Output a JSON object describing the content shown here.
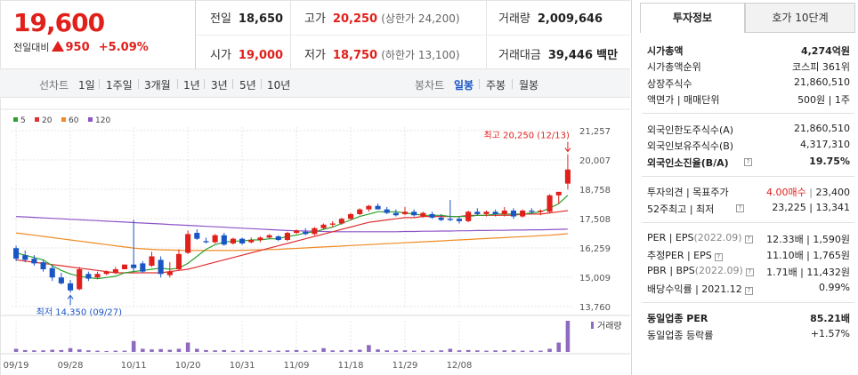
{
  "stock": {
    "price": "19,600",
    "change_label": "전일대비",
    "change_value": "950",
    "change_pct": "+5.09%"
  },
  "quote": {
    "prev_close_label": "전일",
    "prev_close": "18,650",
    "high_label": "고가",
    "high": "20,250",
    "upper_limit": "(상한가 24,200)",
    "volume_label": "거래량",
    "volume": "2,009,646",
    "open_label": "시가",
    "open": "19,000",
    "low_label": "저가",
    "low": "18,750",
    "lower_limit": "(하한가 13,100)",
    "amount_label": "거래대금",
    "amount": "39,446",
    "amount_unit": "백만"
  },
  "period_bar": {
    "line_label": "선차트",
    "line_periods": [
      "1일",
      "1주일",
      "3개월",
      "1년",
      "3년",
      "5년",
      "10년"
    ],
    "candle_label": "봉차트",
    "candle_periods": [
      "일봉",
      "주봉",
      "월봉"
    ],
    "candle_active": "일봉"
  },
  "panel": {
    "tab_info": "투자정보",
    "tab_quote": "호가 10단계",
    "rows1": [
      {
        "label": "시가총액",
        "value": "4,274억원",
        "bold": true
      },
      {
        "label": "시가총액순위",
        "value": "코스피 361위"
      },
      {
        "label": "상장주식수",
        "value": "21,860,510"
      },
      {
        "label": "액면가 | 매매단위",
        "value": "500원 | 1주"
      }
    ],
    "rows2": [
      {
        "label": "외국인한도주식수(A)",
        "value": "21,860,510"
      },
      {
        "label": "외국인보유주식수(B)",
        "value": "4,317,310"
      },
      {
        "label": "외국인소진율(B/A)",
        "value": "19.75%",
        "bold": true
      }
    ],
    "target_label": "투자의견 | 목표주가",
    "target_opinion": "4.00매수",
    "target_price": "23,400",
    "w52_label": "52주최고 | 최저",
    "w52_value": "23,225 | 13,341",
    "rows4": [
      {
        "label": "PER | EPS",
        "sub": "(2022.09)",
        "value": "12.33배 | 1,590원"
      },
      {
        "label": "추정PER | EPS",
        "sub": "",
        "value": "11.10배 | 1,765원"
      },
      {
        "label": "PBR | BPS",
        "sub": "(2022.09)",
        "value": "1.71배 | 11,432원"
      },
      {
        "label": "배당수익률 | 2021.12",
        "sub": "",
        "value": "0.99%"
      }
    ],
    "sector_per_label": "동일업종 PER",
    "sector_per": "85.21배",
    "sector_rate_label": "동일업종 등락률",
    "sector_rate": "+1.57%"
  },
  "colors": {
    "up": "#e0201b",
    "down": "#1a55c5",
    "ma5": "#2ca02c",
    "ma20": "#e03030",
    "ma60": "#f08a24",
    "ma120": "#8e54c8",
    "volume": "#8e6ac0"
  },
  "chart_data": {
    "type": "candlestick",
    "legend": [
      "5",
      "20",
      "60",
      "120"
    ],
    "y_ticks": [
      "21,257",
      "20,007",
      "18,758",
      "17,508",
      "16,259",
      "15,009",
      "13,760"
    ],
    "ylim": [
      13760,
      21257
    ],
    "x_ticks": [
      "09/19",
      "09/28",
      "10/11",
      "10/20",
      "10/31",
      "11/09",
      "11/18",
      "11/29",
      "12/08"
    ],
    "x_tick_index": [
      0,
      6,
      13,
      19,
      25,
      31,
      37,
      43,
      49
    ],
    "annot_high": "최고 20,250 (12/13)",
    "annot_low": "최저 14,350 (09/27)",
    "volume_label": "거래량",
    "candles": [
      {
        "o": 16250,
        "h": 16350,
        "l": 15700,
        "c": 15800
      },
      {
        "o": 15950,
        "h": 16150,
        "l": 15650,
        "c": 15750
      },
      {
        "o": 15800,
        "h": 15950,
        "l": 15500,
        "c": 15600
      },
      {
        "o": 15650,
        "h": 15750,
        "l": 15250,
        "c": 15350
      },
      {
        "o": 15400,
        "h": 15500,
        "l": 14850,
        "c": 15000
      },
      {
        "o": 15000,
        "h": 15200,
        "l": 14700,
        "c": 14750
      },
      {
        "o": 14750,
        "h": 14900,
        "l": 14350,
        "c": 14450
      },
      {
        "o": 14500,
        "h": 15450,
        "l": 14450,
        "c": 15350
      },
      {
        "o": 15150,
        "h": 15250,
        "l": 14850,
        "c": 14950
      },
      {
        "o": 15000,
        "h": 15250,
        "l": 14950,
        "c": 15150
      },
      {
        "o": 15150,
        "h": 15300,
        "l": 15100,
        "c": 15250
      },
      {
        "o": 15200,
        "h": 15450,
        "l": 15150,
        "c": 15350
      },
      {
        "o": 15350,
        "h": 15550,
        "l": 15350,
        "c": 15550
      },
      {
        "o": 15550,
        "h": 17450,
        "l": 15250,
        "c": 15400
      },
      {
        "o": 15600,
        "h": 15700,
        "l": 15200,
        "c": 15250
      },
      {
        "o": 15500,
        "h": 16100,
        "l": 15450,
        "c": 15900
      },
      {
        "o": 15750,
        "h": 15900,
        "l": 15000,
        "c": 15150
      },
      {
        "o": 15100,
        "h": 15650,
        "l": 15000,
        "c": 15250
      },
      {
        "o": 15350,
        "h": 16200,
        "l": 15300,
        "c": 16000
      },
      {
        "o": 16050,
        "h": 17000,
        "l": 16000,
        "c": 16850
      },
      {
        "o": 16900,
        "h": 17050,
        "l": 16600,
        "c": 16650
      },
      {
        "o": 16550,
        "h": 16700,
        "l": 16450,
        "c": 16500
      },
      {
        "o": 16500,
        "h": 16850,
        "l": 16450,
        "c": 16800
      },
      {
        "o": 16800,
        "h": 16900,
        "l": 16350,
        "c": 16400
      },
      {
        "o": 16450,
        "h": 16700,
        "l": 16400,
        "c": 16650
      },
      {
        "o": 16650,
        "h": 16700,
        "l": 16400,
        "c": 16450
      },
      {
        "o": 16500,
        "h": 16700,
        "l": 16450,
        "c": 16600
      },
      {
        "o": 16600,
        "h": 16750,
        "l": 16500,
        "c": 16700
      },
      {
        "o": 16700,
        "h": 16850,
        "l": 16650,
        "c": 16800
      },
      {
        "o": 16750,
        "h": 16800,
        "l": 16550,
        "c": 16600
      },
      {
        "o": 16600,
        "h": 16950,
        "l": 16550,
        "c": 16900
      },
      {
        "o": 16900,
        "h": 17050,
        "l": 16850,
        "c": 17000
      },
      {
        "o": 16950,
        "h": 17100,
        "l": 16800,
        "c": 16850
      },
      {
        "o": 16850,
        "h": 17150,
        "l": 16800,
        "c": 17100
      },
      {
        "o": 17100,
        "h": 17300,
        "l": 17050,
        "c": 17250
      },
      {
        "o": 17250,
        "h": 17400,
        "l": 17150,
        "c": 17300
      },
      {
        "o": 17300,
        "h": 17550,
        "l": 17250,
        "c": 17500
      },
      {
        "o": 17500,
        "h": 17750,
        "l": 17450,
        "c": 17700
      },
      {
        "o": 17700,
        "h": 17950,
        "l": 17650,
        "c": 17900
      },
      {
        "o": 17900,
        "h": 18100,
        "l": 17800,
        "c": 18050
      },
      {
        "o": 18050,
        "h": 18150,
        "l": 17950,
        "c": 17900
      },
      {
        "o": 17900,
        "h": 18000,
        "l": 17700,
        "c": 17750
      },
      {
        "o": 17750,
        "h": 17900,
        "l": 17600,
        "c": 17650
      },
      {
        "o": 17700,
        "h": 18000,
        "l": 17650,
        "c": 17800
      },
      {
        "o": 17800,
        "h": 17900,
        "l": 17600,
        "c": 17650
      },
      {
        "o": 17600,
        "h": 17800,
        "l": 17550,
        "c": 17750
      },
      {
        "o": 17700,
        "h": 17800,
        "l": 17500,
        "c": 17550
      },
      {
        "o": 17550,
        "h": 17700,
        "l": 17400,
        "c": 17450
      },
      {
        "o": 17500,
        "h": 18300,
        "l": 17400,
        "c": 17450
      },
      {
        "o": 17500,
        "h": 17600,
        "l": 17300,
        "c": 17400
      },
      {
        "o": 17400,
        "h": 17850,
        "l": 17350,
        "c": 17800
      },
      {
        "o": 17800,
        "h": 17950,
        "l": 17650,
        "c": 17700
      },
      {
        "o": 17700,
        "h": 17850,
        "l": 17600,
        "c": 17800
      },
      {
        "o": 17800,
        "h": 17900,
        "l": 17600,
        "c": 17700
      },
      {
        "o": 17700,
        "h": 18000,
        "l": 17600,
        "c": 17850
      },
      {
        "o": 17850,
        "h": 17950,
        "l": 17500,
        "c": 17600
      },
      {
        "o": 17600,
        "h": 17900,
        "l": 17550,
        "c": 17850
      },
      {
        "o": 17850,
        "h": 17950,
        "l": 17700,
        "c": 17800
      },
      {
        "o": 17800,
        "h": 17900,
        "l": 17650,
        "c": 17850
      },
      {
        "o": 17800,
        "h": 18550,
        "l": 17750,
        "c": 18500
      },
      {
        "o": 18500,
        "h": 18650,
        "l": 18150,
        "c": 18650
      },
      {
        "o": 19000,
        "h": 20250,
        "l": 18750,
        "c": 19600
      }
    ],
    "volumes": [
      0.1,
      0.06,
      0.05,
      0.05,
      0.07,
      0.06,
      0.12,
      0.08,
      0.05,
      0.04,
      0.03,
      0.04,
      0.04,
      0.35,
      0.1,
      0.08,
      0.09,
      0.07,
      0.1,
      0.3,
      0.1,
      0.06,
      0.05,
      0.06,
      0.04,
      0.05,
      0.05,
      0.04,
      0.04,
      0.04,
      0.05,
      0.06,
      0.04,
      0.05,
      0.12,
      0.05,
      0.05,
      0.06,
      0.07,
      0.22,
      0.08,
      0.05,
      0.05,
      0.05,
      0.04,
      0.04,
      0.04,
      0.05,
      0.1,
      0.05,
      0.06,
      0.05,
      0.04,
      0.05,
      0.05,
      0.05,
      0.04,
      0.04,
      0.04,
      0.1,
      0.3,
      1.0
    ],
    "ma5": [
      16050,
      15950,
      15850,
      15750,
      15500,
      15300,
      15150,
      15050,
      15000,
      14950,
      15000,
      15050,
      15200,
      15250,
      15300,
      15350,
      15400,
      15350,
      15400,
      15600,
      15900,
      16200,
      16400,
      16500,
      16550,
      16550,
      16600,
      16600,
      16650,
      16650,
      16750,
      16800,
      16900,
      16950,
      17050,
      17150,
      17300,
      17450,
      17600,
      17700,
      17800,
      17800,
      17800,
      17750,
      17700,
      17650,
      17650,
      17650,
      17600,
      17600,
      17600,
      17650,
      17650,
      17700,
      17700,
      17700,
      17700,
      17750,
      17800,
      17950,
      18150,
      18500
    ],
    "ma20": [
      15750,
      15700,
      15650,
      15600,
      15550,
      15500,
      15450,
      15400,
      15350,
      15300,
      15250,
      15200,
      15200,
      15200,
      15200,
      15200,
      15200,
      15250,
      15300,
      15350,
      15450,
      15550,
      15650,
      15750,
      15850,
      15950,
      16050,
      16150,
      16250,
      16350,
      16450,
      16550,
      16650,
      16750,
      16850,
      16950,
      17050,
      17150,
      17250,
      17350,
      17400,
      17450,
      17500,
      17550,
      17550,
      17600,
      17600,
      17600,
      17600,
      17600,
      17650,
      17650,
      17650,
      17650,
      17650,
      17650,
      17700,
      17700,
      17700,
      17750,
      17800,
      17850
    ],
    "ma60": [
      16900,
      16850,
      16800,
      16750,
      16700,
      16650,
      16600,
      16550,
      16500,
      16450,
      16400,
      16350,
      16300,
      16250,
      16220,
      16200,
      16180,
      16170,
      16160,
      16150,
      16150,
      16150,
      16150,
      16150,
      16150,
      16160,
      16170,
      16180,
      16190,
      16200,
      16220,
      16240,
      16260,
      16280,
      16300,
      16320,
      16340,
      16360,
      16380,
      16400,
      16420,
      16440,
      16460,
      16480,
      16500,
      16520,
      16540,
      16560,
      16580,
      16600,
      16620,
      16640,
      16660,
      16680,
      16700,
      16720,
      16740,
      16760,
      16780,
      16800,
      16830,
      16870
    ],
    "ma120": [
      17600,
      17580,
      17560,
      17540,
      17520,
      17500,
      17480,
      17460,
      17440,
      17420,
      17400,
      17380,
      17360,
      17340,
      17320,
      17300,
      17280,
      17260,
      17240,
      17220,
      17200,
      17180,
      17160,
      17140,
      17120,
      17100,
      17080,
      17060,
      17040,
      17020,
      17000,
      16990,
      16980,
      16970,
      16960,
      16950,
      16950,
      16950,
      16950,
      16950,
      16950,
      16950,
      16950,
      16960,
      16960,
      16970,
      16970,
      16980,
      16980,
      16990,
      16990,
      17000,
      17000,
      17010,
      17010,
      17020,
      17020,
      17030,
      17030,
      17040,
      17050,
      17060
    ]
  }
}
